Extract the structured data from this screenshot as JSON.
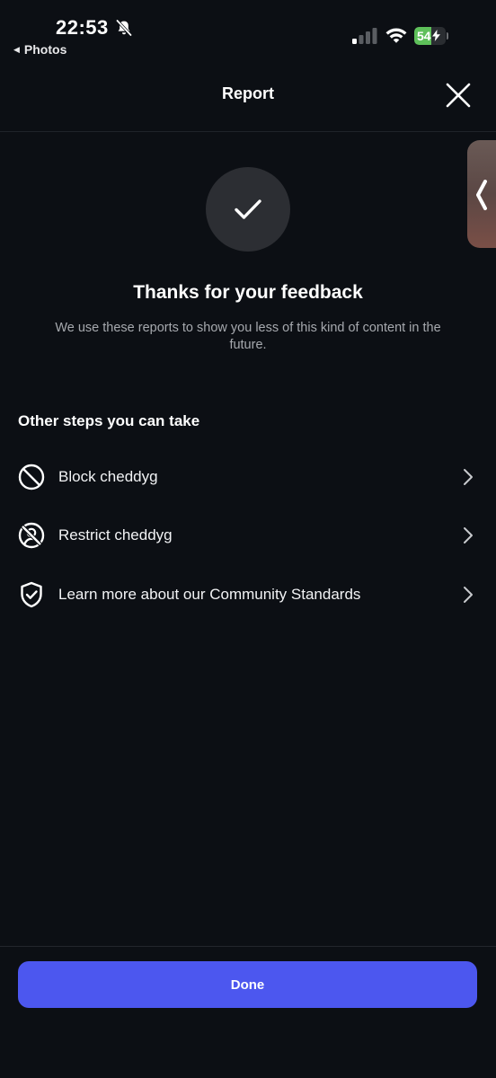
{
  "status_bar": {
    "time": "22:53",
    "back_app": "Photos",
    "battery_percent": 54,
    "battery_label": "54",
    "battery_color": "#5ec05a"
  },
  "header": {
    "title": "Report",
    "close_icon": "close-icon"
  },
  "confirmation": {
    "icon": "checkmark-icon",
    "title": "Thanks for your feedback",
    "body": "We use these reports to show you less of this kind of content in the future."
  },
  "steps": {
    "heading": "Other steps you can take",
    "items": [
      {
        "icon": "block-icon",
        "label": "Block cheddyg"
      },
      {
        "icon": "restrict-icon",
        "label": "Restrict cheddyg"
      },
      {
        "icon": "shield-check-icon",
        "label": "Learn more about our Community Standards"
      }
    ]
  },
  "footer": {
    "done_label": "Done",
    "accent_color": "#4c57ef"
  }
}
